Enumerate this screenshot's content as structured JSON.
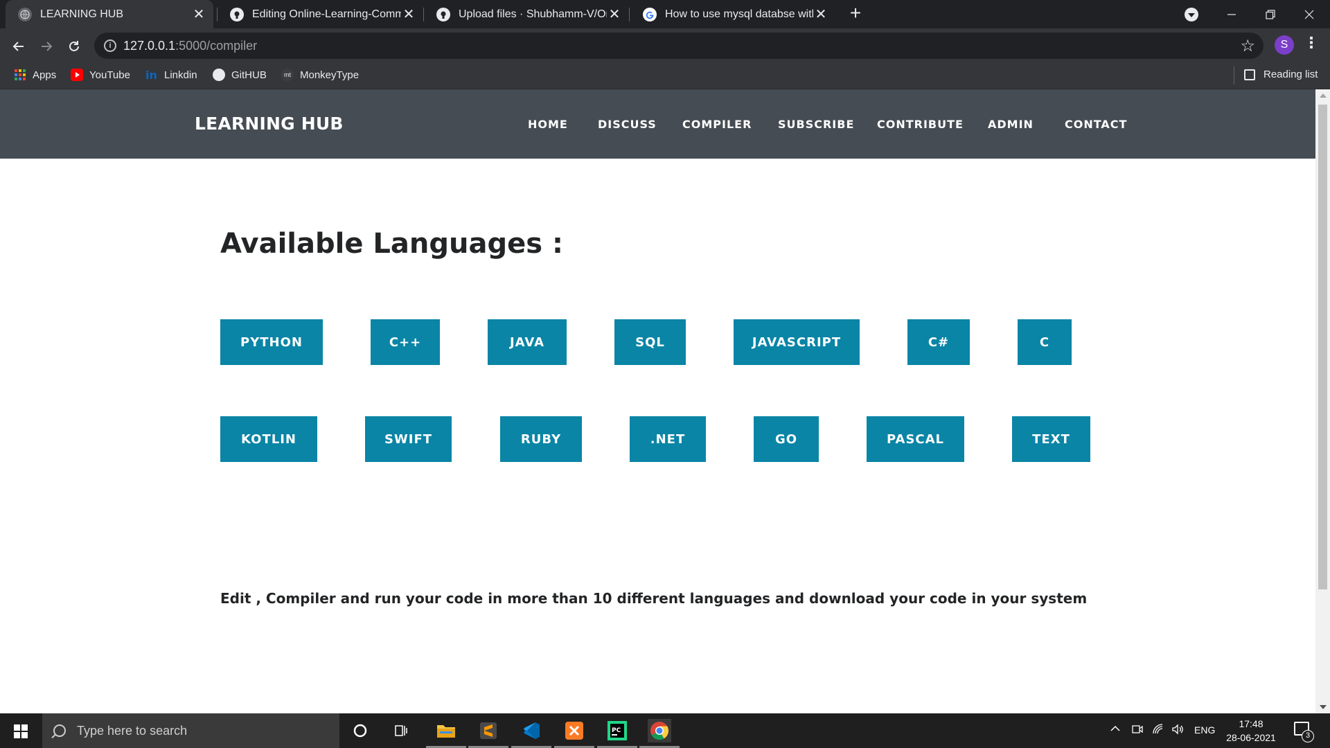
{
  "browser": {
    "tabs": [
      {
        "title": "LEARNING HUB",
        "active": true,
        "icon": "globe-icon"
      },
      {
        "title": "Editing Online-Learning-Commun",
        "active": false,
        "icon": "github-icon"
      },
      {
        "title": "Upload files · Shubhamm-V/Onlin",
        "active": false,
        "icon": "github-icon"
      },
      {
        "title": "How to use mysql databse with f",
        "active": false,
        "icon": "google-icon"
      }
    ],
    "close_glyph": "✕",
    "new_tab_glyph": "+",
    "url_host": "127.0.0.1",
    "url_path": ":5000/compiler",
    "profile_initial": "S",
    "bookmarks": [
      {
        "label": "Apps",
        "icon": "apps-grid-icon"
      },
      {
        "label": "YouTube",
        "icon": "youtube-icon"
      },
      {
        "label": "Linkdin",
        "icon": "linkedin-icon"
      },
      {
        "label": "GitHUB",
        "icon": "github-icon"
      },
      {
        "label": "MonkeyType",
        "icon": "monkeytype-icon"
      }
    ],
    "reading_list": "Reading list"
  },
  "site": {
    "brand": "LEARNING HUB",
    "nav": [
      "HOME",
      "DISCUSS",
      "COMPILER",
      "SUBSCRIBE",
      "CONTRIBUTE",
      "ADMIN",
      "CONTACT"
    ],
    "heading": "Available Languages :",
    "languages_row1": [
      "PYTHON",
      "C++",
      "JAVA",
      "SQL",
      "JAVASCRIPT",
      "C#",
      "C"
    ],
    "languages_row2": [
      "KOTLIN",
      "SWIFT",
      "RUBY",
      ".NET",
      "GO",
      "PASCAL",
      "TEXT"
    ],
    "description": "Edit , Compiler and run your code in more than 10 different languages and download your code in your system",
    "accent_color": "#0a85a6",
    "nav_bg_color": "#454c53"
  },
  "taskbar": {
    "search_placeholder": "Type here to search",
    "apps": [
      "cortana-icon",
      "task-view-icon",
      "file-explorer-icon",
      "sublime-text-icon",
      "vscode-icon",
      "xampp-icon",
      "pycharm-icon",
      "chrome-icon"
    ],
    "language": "ENG",
    "time": "17:48",
    "date": "28-06-2021",
    "notifications": "3"
  }
}
